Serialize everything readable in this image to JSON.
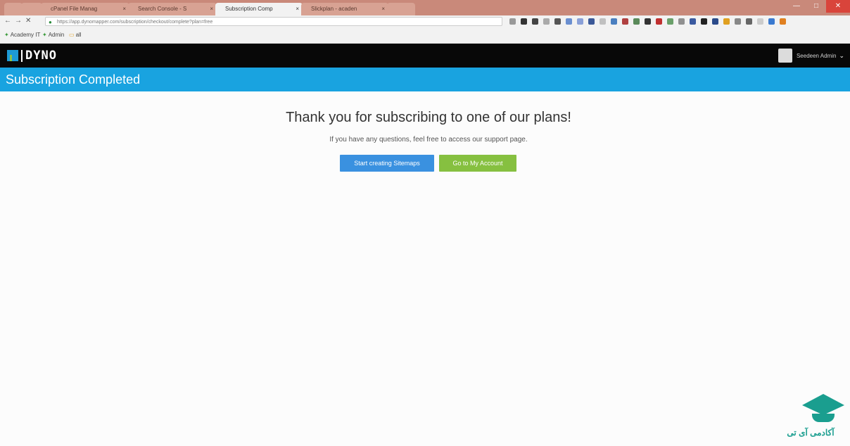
{
  "browser": {
    "tabs": [
      {
        "label": "",
        "active": false
      },
      {
        "label": "",
        "active": false
      },
      {
        "label": "cPanel File Manag",
        "active": false
      },
      {
        "label": "Search Console - S",
        "active": false
      },
      {
        "label": "Subscription Comp",
        "active": true
      },
      {
        "label": "Slickplan - acaden",
        "active": false
      },
      {
        "label": "",
        "active": false
      }
    ],
    "url": "https://app.dynomapper.com/subscription/checkout/complete?plan=free",
    "bookmarks": [
      {
        "label": "Academy IT"
      },
      {
        "label": "Admin"
      },
      {
        "label": "all"
      }
    ],
    "window_controls": {
      "minimize": "—",
      "maximize": "□",
      "close": "✕"
    }
  },
  "app": {
    "logo_text": "DYNO",
    "user_name": "Seedeen Admin",
    "page_title": "Subscription Completed"
  },
  "main": {
    "headline": "Thank you for subscribing to one of our plans!",
    "subtext": "If you have any questions, feel free to access our support page.",
    "primary_button": "Start creating Sitemaps",
    "secondary_button": "Go to My Account"
  },
  "colors": {
    "title_bar": "#19a3e0",
    "header": "#080808",
    "primary_button": "#3a91e0",
    "secondary_button": "#86c040",
    "tab_strip": "#c9897a"
  },
  "watermark": {
    "text": "آکادمی آی تی"
  }
}
